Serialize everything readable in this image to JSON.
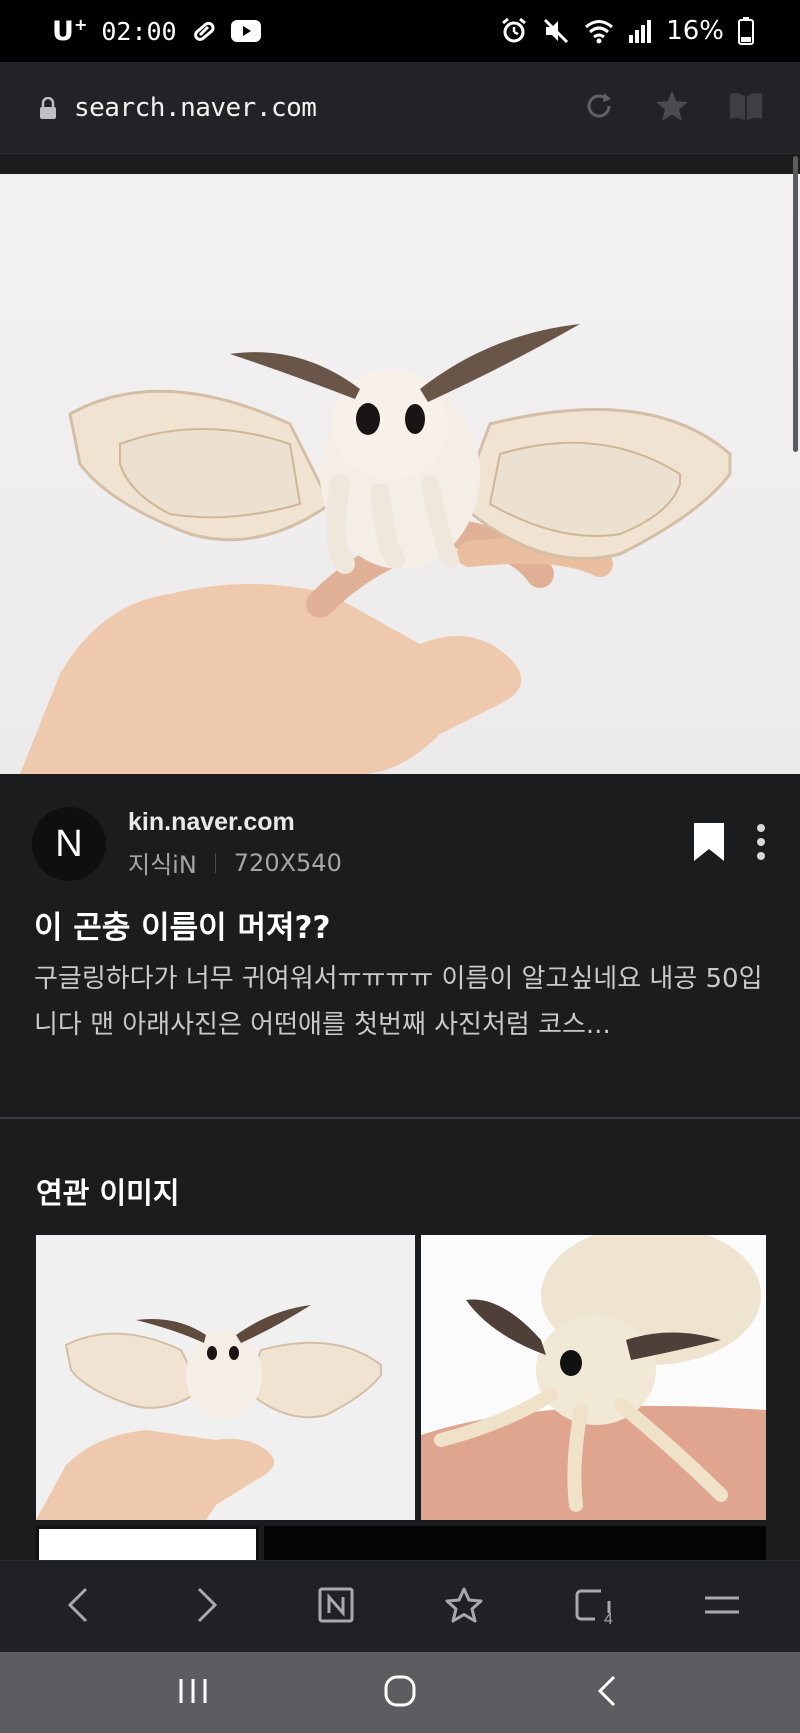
{
  "status_bar": {
    "carrier": "U",
    "carrier_sup": "+",
    "time": "02:00",
    "battery": "16%"
  },
  "url_bar": {
    "url": "search.naver.com"
  },
  "result": {
    "avatar_letter": "N",
    "domain": "kin.naver.com",
    "source_name": "지식iN",
    "dimensions": "720X540",
    "title": "이 곤충 이름이 머져??",
    "description": "구글링하다가 너무 귀여워서ㅠㅠㅠㅠ 이름이 알고싶네요 내공 50입니다 맨 아래사진은 어떤애를 첫번째 사진처럼 코스..."
  },
  "related": {
    "heading": "연관 이미지"
  },
  "browser_nav": {
    "tab_count": "4"
  },
  "icons": {
    "lock": "lock-icon",
    "refresh": "refresh-icon",
    "star": "star-icon",
    "reader": "book-icon",
    "bookmark": "bookmark-icon",
    "more": "more-vertical-icon",
    "back": "chevron-left-icon",
    "forward": "chevron-right-icon",
    "naver_home": "naver-n-icon",
    "tabs": "tabs-icon",
    "menu": "menu-icon"
  }
}
